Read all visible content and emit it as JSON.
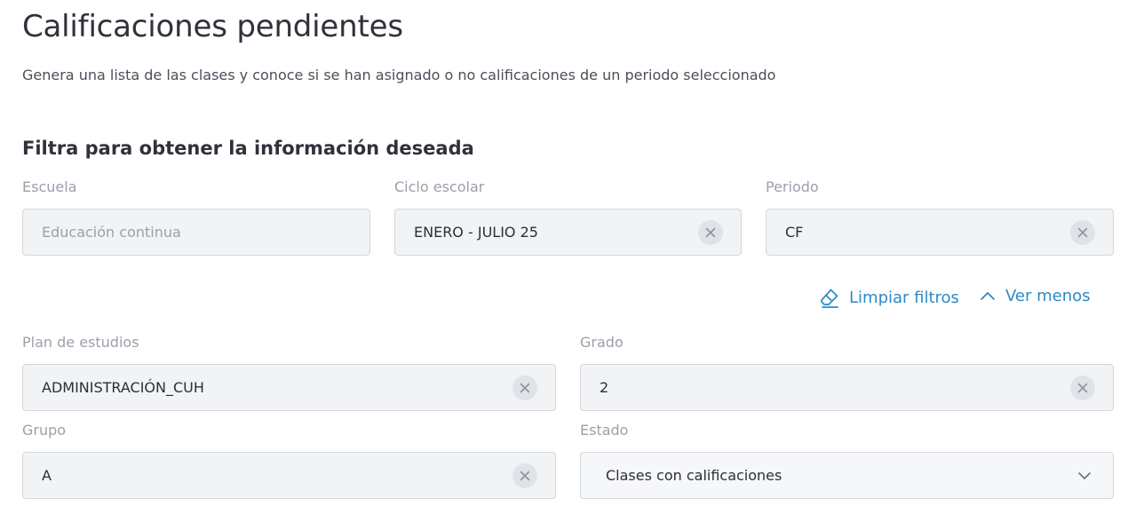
{
  "header": {
    "title": "Calificaciones pendientes",
    "subtitle": "Genera una lista de las clases y conoce si se han asignado o no calificaciones de un periodo seleccionado"
  },
  "filters": {
    "section_title": "Filtra para obtener la información deseada",
    "escuela": {
      "label": "Escuela",
      "value": "Educación continua"
    },
    "ciclo": {
      "label": "Ciclo escolar",
      "value": "ENERO - JULIO 25"
    },
    "periodo": {
      "label": "Periodo",
      "value": "CF"
    },
    "plan": {
      "label": "Plan de estudios",
      "value": "ADMINISTRACIÓN_CUH"
    },
    "grado": {
      "label": "Grado",
      "value": "2"
    },
    "grupo": {
      "label": "Grupo",
      "value": "A"
    },
    "estado": {
      "label": "Estado",
      "value": "Clases con calificaciones"
    }
  },
  "actions": {
    "clear_label": "Limpiar filtros",
    "less_label": "Ver menos"
  },
  "colors": {
    "accent": "#2d8ac6",
    "field_bg": "#f1f3f5",
    "label": "#9aa1ab"
  }
}
